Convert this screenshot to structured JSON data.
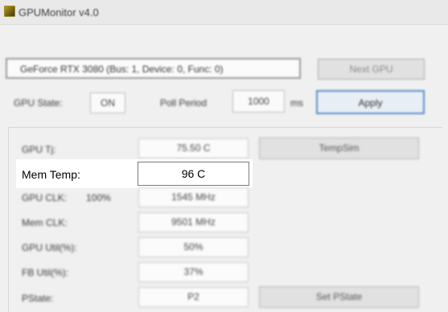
{
  "window": {
    "title": "GPUMonitor v4.0"
  },
  "top": {
    "gpu_select_value": "GeForce RTX 3080 (Bus: 1, Device: 0, Func: 0)",
    "next_gpu_label": "Next GPU",
    "gpu_state_label": "GPU State:",
    "gpu_state_value": "ON",
    "poll_period_label": "Poll Period",
    "poll_period_value": "1000",
    "poll_period_unit": "ms",
    "apply_label": "Apply"
  },
  "readings": {
    "gpu_temp_label": "GPU Tj:",
    "gpu_temp_value": "75.50 C",
    "mem_temp_label": "Mem Temp:",
    "mem_temp_value": "96 C",
    "gpu_clock_label": "GPU CLK:",
    "gpu_clock_percent": "100%",
    "gpu_clock_value": "1545 MHz",
    "mem_clock_label": "Mem CLK:",
    "mem_clock_value": "9501 MHz",
    "gpu_util_label": "GPU Util(%):",
    "gpu_util_value": "50%",
    "fb_util_label": "FB Util(%):",
    "fb_util_value": "37%",
    "pstate_label": "PState:",
    "pstate_value": "P2"
  },
  "buttons": {
    "temp_sim_label": "TempSim",
    "set_pstate_label": "Set PState"
  }
}
